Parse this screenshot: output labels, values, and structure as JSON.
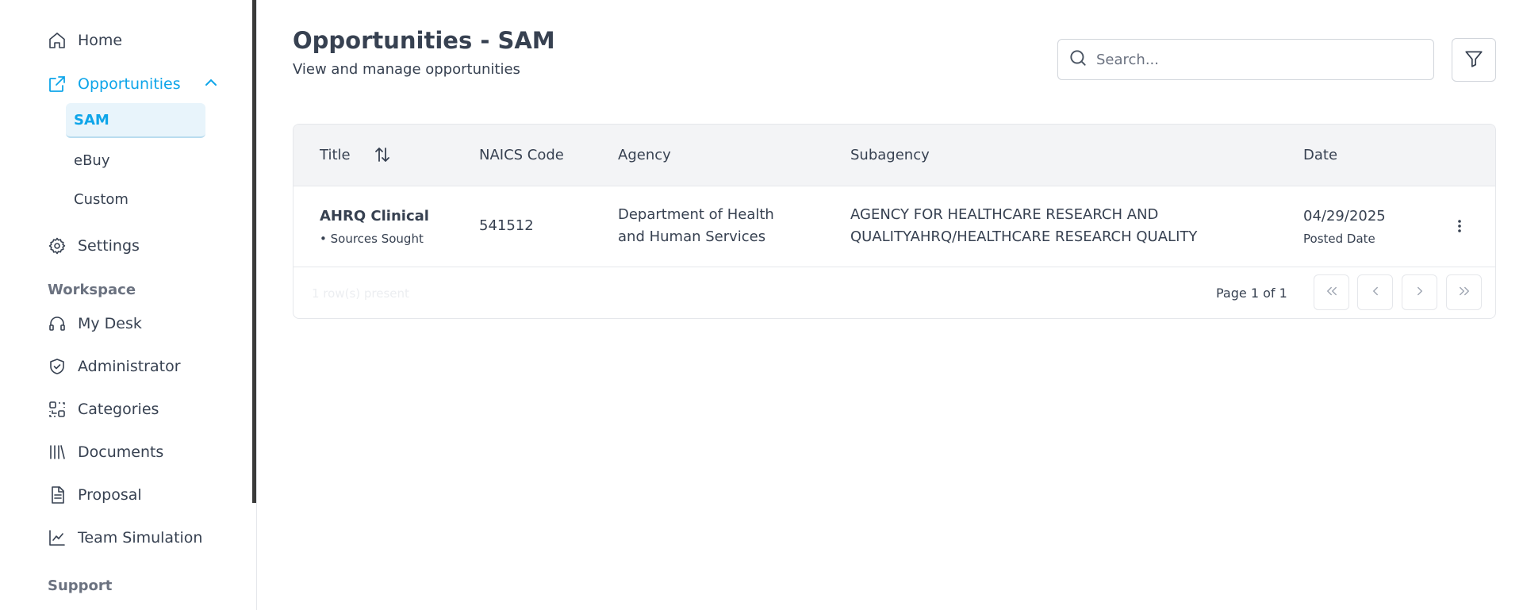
{
  "sidebar": {
    "items": [
      {
        "label": "Home",
        "icon": "home-icon"
      },
      {
        "label": "Opportunities",
        "icon": "external-link-icon"
      },
      {
        "label": "Settings",
        "icon": "gear-icon"
      }
    ],
    "sub_items": [
      {
        "label": "SAM"
      },
      {
        "label": "eBuy"
      },
      {
        "label": "Custom"
      }
    ],
    "workspace_label": "Workspace",
    "workspace_items": [
      {
        "label": "My Desk",
        "icon": "headset-icon"
      },
      {
        "label": "Administrator",
        "icon": "shield-check-icon"
      },
      {
        "label": "Categories",
        "icon": "categories-icon"
      },
      {
        "label": "Documents",
        "icon": "library-icon"
      },
      {
        "label": "Proposal",
        "icon": "document-icon"
      },
      {
        "label": "Team Simulation",
        "icon": "line-chart-icon"
      }
    ],
    "support_label": "Support"
  },
  "header": {
    "title": "Opportunities - SAM",
    "subtitle": "View and manage opportunities"
  },
  "search": {
    "placeholder": "Search..."
  },
  "table": {
    "columns": [
      "Title",
      "NAICS Code",
      "Agency",
      "Subagency",
      "Date"
    ],
    "rows": [
      {
        "title": "AHRQ Clinical D",
        "type": "• Sources Sought",
        "naics": "541512",
        "agency_line1": "Department of Health",
        "agency_line2": "and Human Services",
        "subagency_line1": "AGENCY FOR HEALTHCARE RESEARCH AND",
        "subagency_line2": "QUALITYAHRQ/HEALTHCARE RESEARCH QUALITY",
        "date": "04/29/2025",
        "date_label": "Posted Date"
      }
    ],
    "footer_rows": "1 row(s) present",
    "page_info": "Page 1 of 1"
  },
  "colors": {
    "accent": "#0ea5e9",
    "active_bg": "#e8f4fb",
    "header_bg": "#f3f4f6",
    "text": "#374151"
  }
}
